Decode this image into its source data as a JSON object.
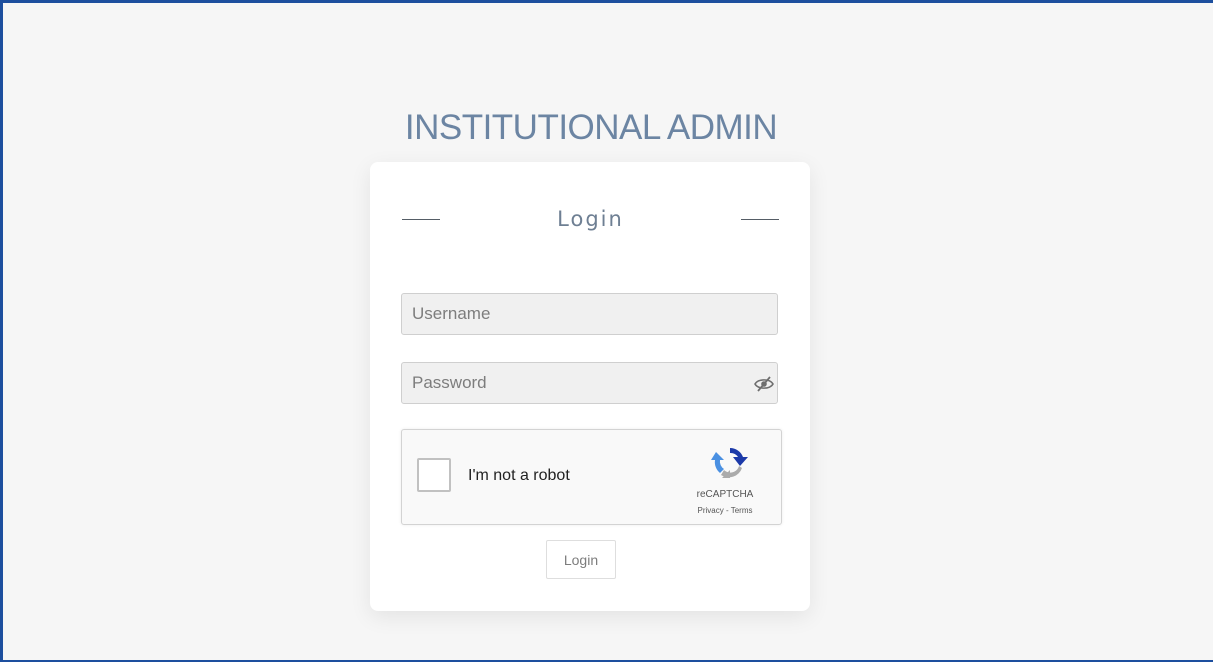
{
  "app_title": "INSTITUTIONAL ADMIN",
  "login_card": {
    "heading": "Login",
    "username": {
      "value": "",
      "placeholder": "Username"
    },
    "password": {
      "value": "",
      "placeholder": "Password",
      "toggle_icon": "eye-slash-icon"
    },
    "recaptcha": {
      "checkbox_label": "I'm not a robot",
      "checked": false,
      "brand": "reCAPTCHA",
      "privacy_link": "Privacy",
      "separator": " - ",
      "terms_link": "Terms",
      "logo_icon": "recaptcha-logo-icon"
    },
    "submit_label": "Login"
  },
  "colors": {
    "page_background": "#f6f6f6",
    "frame_border": "#1d4f9e",
    "title_text": "#6c85a3",
    "recaptcha_blue": "#1c3aa9",
    "recaptcha_light_blue": "#4a90e2",
    "recaptcha_gray": "#ababab"
  }
}
